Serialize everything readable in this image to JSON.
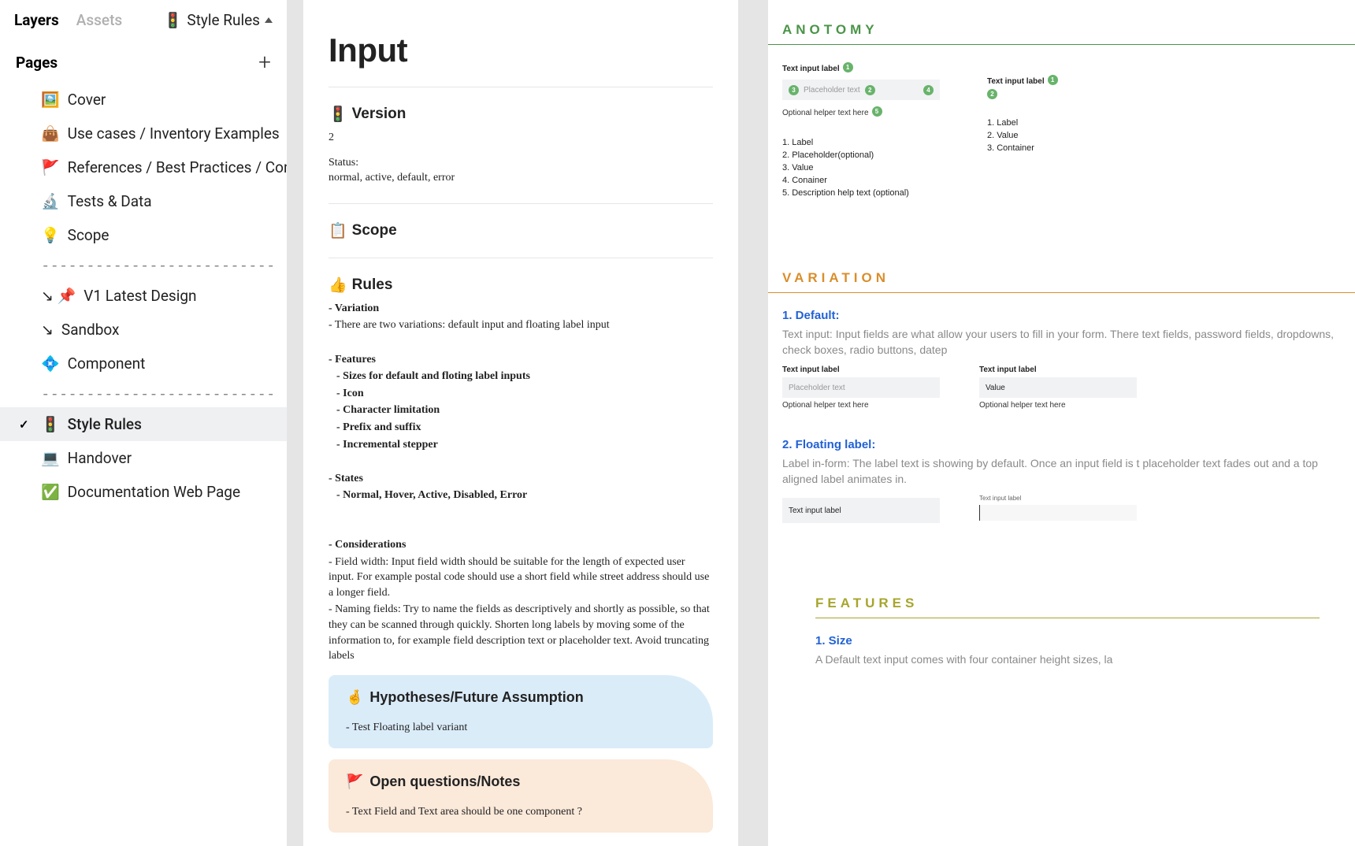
{
  "sidebar": {
    "tabs": {
      "layers": "Layers",
      "assets": "Assets"
    },
    "fileLabel": "Style Rules",
    "fileIcon": "🚦",
    "pagesTitle": "Pages",
    "pages": [
      {
        "icon": "🖼️",
        "label": "Cover"
      },
      {
        "icon": "👜",
        "label": "Use cases / Inventory Examples"
      },
      {
        "icon": "🚩",
        "label": "References  / Best Practices / Com..."
      },
      {
        "icon": "🔬",
        "label": "Tests & Data"
      },
      {
        "icon": "💡",
        "label": "Scope"
      },
      {
        "sep": true,
        "label": "--------------------------"
      },
      {
        "icon": "↘ 📌",
        "label": "V1  Latest Design"
      },
      {
        "icon": "↘",
        "label": "Sandbox"
      },
      {
        "icon": "💠",
        "label": "Component"
      },
      {
        "sep": true,
        "label": "--------------------------"
      },
      {
        "icon": "🚦",
        "label": "Style Rules",
        "selected": true
      },
      {
        "icon": "💻",
        "label": "Handover"
      },
      {
        "icon": "✅",
        "label": "Documentation Web Page"
      }
    ]
  },
  "doc": {
    "title": "Input",
    "version": {
      "icon": "🚦",
      "head": "Version",
      "number": "2",
      "statusLabel": "Status:",
      "status": "normal, active, default, error"
    },
    "scope": {
      "icon": "📋",
      "head": "Scope"
    },
    "rules": {
      "icon": "👍",
      "head": "Rules",
      "variationHead": "- Variation",
      "variationBody": "- There are two variations: default input and floating label input",
      "featuresHead": "- Features",
      "features": [
        "- Sizes for default and floting label inputs",
        "- Icon",
        "- Character limitation",
        "- Prefix and suffix",
        "- Incremental stepper"
      ],
      "statesHead": "- States",
      "statesBody": "- Normal, Hover, Active, Disabled, Error",
      "consHead": "- Considerations",
      "cons1": "- Field width: Input field width should be suitable for the length of expected user input. For example postal code should use a short field while street address should use a longer field.",
      "cons2": "- Naming fields: Try to name the fields as descriptively and shortly as possible, so that they can be scanned through quickly. Shorten long labels by moving some of the information to, for example field description text or placeholder text. Avoid truncating labels"
    },
    "hypo": {
      "icon": "🤞",
      "head": "Hypotheses/Future Assumption",
      "body": "- Test Floating label variant"
    },
    "open": {
      "icon": "🚩",
      "head": "Open questions/Notes",
      "body": "- Text Field and Text area should be one component ?"
    }
  },
  "spec": {
    "anat": {
      "title": "ANOTOMY",
      "label": "Text input label",
      "placeholder": "Placeholder text",
      "helper": "Optional helper text here",
      "value": "Value",
      "list1": [
        "1. Label",
        "2. Placeholder(optional)",
        "3. Value",
        "4. Conainer",
        "5.  Description help text (optional)"
      ],
      "list2": [
        "1. Label",
        "2. Value",
        "3. Container"
      ]
    },
    "var": {
      "title": "VARIATION",
      "defHead": "1. Default:",
      "defBody": "Text input: Input fields are what allow your users to fill in your form. There text fields, password fields, dropdowns, check boxes, radio buttons, datep",
      "floatHead": "2. Floating label:",
      "floatBody": "Label in-form: The label text is showing by default. Once an input field is t placeholder text fades out and a top aligned label animates in.",
      "label": "Text input label",
      "placeholder": "Placeholder text",
      "value": "Value",
      "helper": "Optional helper text here"
    },
    "feat": {
      "title": "FEATURES",
      "sizeHead": "1. Size",
      "sizeBody": "A  Default text input comes with four container height sizes, la"
    }
  }
}
